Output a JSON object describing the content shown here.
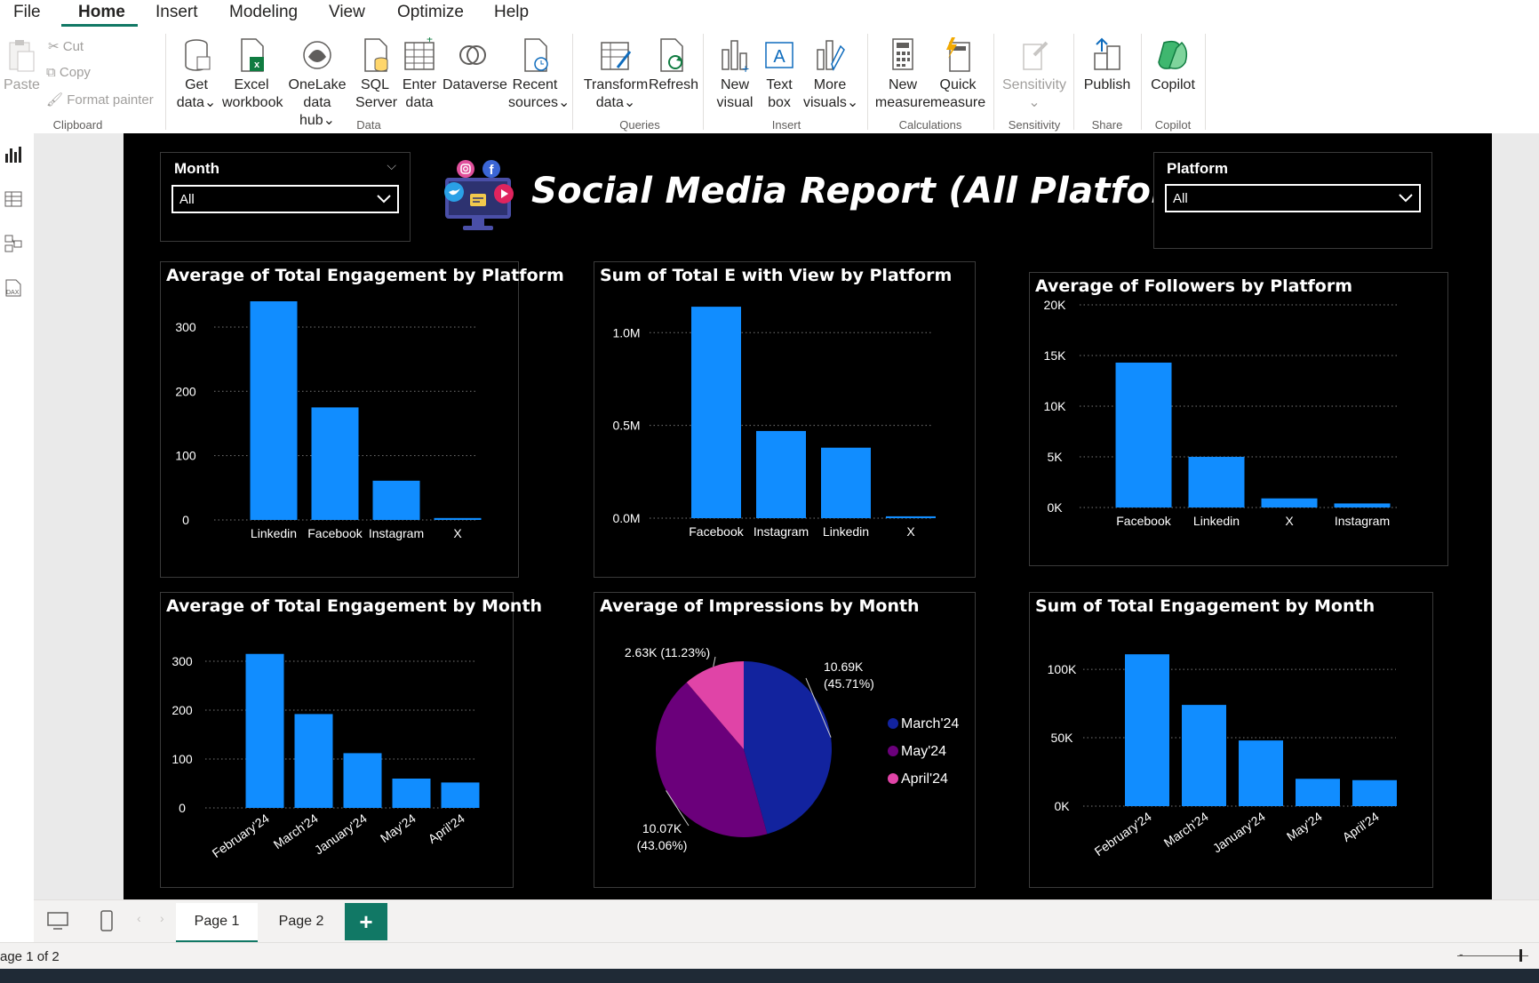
{
  "menu": {
    "items": [
      "File",
      "Home",
      "Insert",
      "Modeling",
      "View",
      "Optimize",
      "Help"
    ],
    "active": "Home"
  },
  "ribbon": {
    "clipboard": {
      "paste": "Paste",
      "cut": "Cut",
      "copy": "Copy",
      "format_painter": "Format painter",
      "group": "Clipboard"
    },
    "data": {
      "get_data": [
        "Get",
        "data"
      ],
      "excel": [
        "Excel",
        "workbook"
      ],
      "onelake": [
        "OneLake",
        "data hub"
      ],
      "sql": [
        "SQL",
        "Server"
      ],
      "enter": [
        "Enter",
        "data"
      ],
      "dataverse": "Dataverse",
      "recent": [
        "Recent",
        "sources"
      ],
      "group": "Data"
    },
    "queries": {
      "transform": [
        "Transform",
        "data"
      ],
      "refresh": "Refresh",
      "group": "Queries"
    },
    "insert": {
      "new_visual": [
        "New",
        "visual"
      ],
      "text_box": [
        "Text",
        "box"
      ],
      "more_visuals": [
        "More",
        "visuals"
      ],
      "group": "Insert"
    },
    "calculations": {
      "new_measure": [
        "New",
        "measure"
      ],
      "quick_measure": [
        "Quick",
        "measure"
      ],
      "group": "Calculations"
    },
    "sensitivity": {
      "label": "Sensitivity",
      "group": "Sensitivity"
    },
    "share": {
      "publish": "Publish",
      "group": "Share"
    },
    "copilot": {
      "label": "Copilot",
      "group": "Copilot"
    }
  },
  "report": {
    "title": "Social Media Report (All Platforms)",
    "month_slicer": {
      "title": "Month",
      "value": "All"
    },
    "platform_slicer": {
      "title": "Platform",
      "value": "All"
    }
  },
  "colors": {
    "bar": "#118DFF",
    "pie_march": "#12239E",
    "pie_may": "#6B007B",
    "pie_april": "#E044A7",
    "background": "#000000"
  },
  "chart_data": [
    {
      "id": "c1",
      "type": "bar",
      "title": "Average of Total Engagement by Platform",
      "categories": [
        "Linkedin",
        "Facebook",
        "Instagram",
        "X"
      ],
      "values": [
        340,
        175,
        61,
        3
      ],
      "ylim": [
        0,
        340
      ],
      "yticks": [
        0,
        100,
        200,
        300
      ],
      "yticklabels": [
        "0",
        "100",
        "200",
        "300"
      ],
      "grid": true
    },
    {
      "id": "c2",
      "type": "bar",
      "title": "Sum of Total E with View by Platform",
      "categories": [
        "Facebook",
        "Instagram",
        "Linkedin",
        "X"
      ],
      "values": [
        1140000,
        470000,
        380000,
        10000
      ],
      "ylim": [
        0,
        1150000
      ],
      "yticks": [
        0,
        500000,
        1000000
      ],
      "yticklabels": [
        "0.0M",
        "0.5M",
        "1.0M"
      ],
      "grid": true
    },
    {
      "id": "c3",
      "type": "bar",
      "title": "Average of Followers by Platform",
      "categories": [
        "Facebook",
        "Linkedin",
        "X",
        "Instagram"
      ],
      "values": [
        14300,
        5000,
        900,
        400
      ],
      "ylim": [
        0,
        20000
      ],
      "yticks": [
        0,
        5000,
        10000,
        15000,
        20000
      ],
      "yticklabels": [
        "0K",
        "5K",
        "10K",
        "15K",
        "20K"
      ],
      "grid": true
    },
    {
      "id": "c4",
      "type": "bar",
      "title": "Average of Total Engagement by Month",
      "categories": [
        "February'24",
        "March'24",
        "January'24",
        "May'24",
        "April'24"
      ],
      "values": [
        315,
        192,
        112,
        60,
        52
      ],
      "ylim": [
        0,
        320
      ],
      "yticks": [
        0,
        100,
        200,
        300
      ],
      "yticklabels": [
        "0",
        "100",
        "200",
        "300"
      ],
      "grid": true
    },
    {
      "id": "c5",
      "type": "pie",
      "title": "Average of Impressions by Month",
      "labels": [
        "March'24",
        "May'24",
        "April'24"
      ],
      "values": [
        10690,
        10070,
        2630
      ],
      "percent_labels": [
        "10.69K (45.71%)",
        "10.07K (43.06%)",
        "2.63K (11.23%)"
      ],
      "data_labels": [
        [
          "10.69K",
          "(45.71%)"
        ],
        [
          "10.07K",
          "(43.06%)"
        ],
        [
          "2.63K (11.23%)"
        ]
      ],
      "legend": "right"
    },
    {
      "id": "c6",
      "type": "bar",
      "title": "Sum of Total Engagement by Month",
      "categories": [
        "February'24",
        "March'24",
        "January'24",
        "May'24",
        "April'24"
      ],
      "values": [
        111000,
        74000,
        48000,
        20000,
        19000
      ],
      "ylim": [
        0,
        115000
      ],
      "yticks": [
        0,
        50000,
        100000
      ],
      "yticklabels": [
        "0K",
        "50K",
        "100K"
      ],
      "grid": true
    }
  ],
  "pages": {
    "tabs": [
      "Page 1",
      "Page 2"
    ],
    "add": "+",
    "status": "age 1 of 2"
  }
}
